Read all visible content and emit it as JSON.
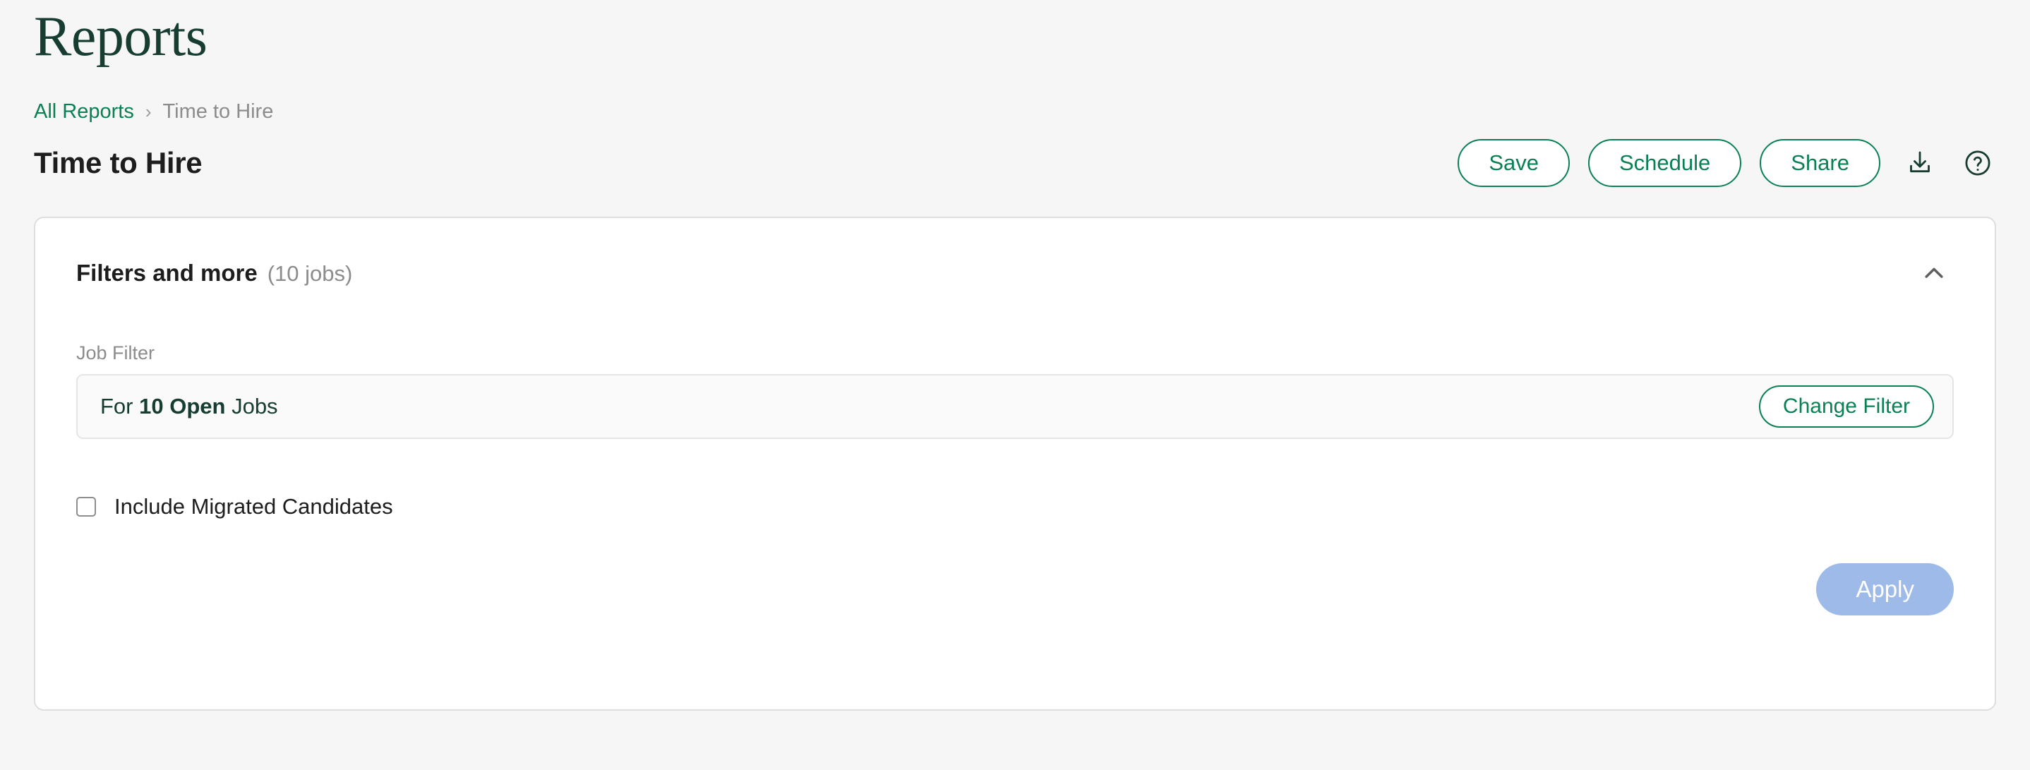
{
  "page": {
    "title": "Reports",
    "background": "#f6f6f6"
  },
  "breadcrumb": {
    "root_label": "All Reports",
    "separator": "›",
    "current_label": "Time to Hire"
  },
  "report": {
    "title": "Time to Hire"
  },
  "header_actions": {
    "save_label": "Save",
    "schedule_label": "Schedule",
    "share_label": "Share",
    "download_icon": "download-icon",
    "help_icon": "help-circle-icon"
  },
  "filters_card": {
    "title": "Filters and more",
    "subtitle": "(10 jobs)",
    "collapse_icon": "chevron-up-icon",
    "job_filter": {
      "label": "Job Filter",
      "prefix": "For",
      "count_and_status": "10 Open",
      "suffix": "Jobs",
      "change_filter_label": "Change Filter"
    },
    "include_migrated": {
      "label": "Include Migrated Candidates",
      "checked": false
    },
    "apply_label": "Apply"
  },
  "colors": {
    "brand_green": "#0a8055",
    "dark_green": "#173c31",
    "muted_gray": "#8c8c8c",
    "apply_disabled_blue": "#9dbae9",
    "card_border": "#dcdfdd"
  }
}
